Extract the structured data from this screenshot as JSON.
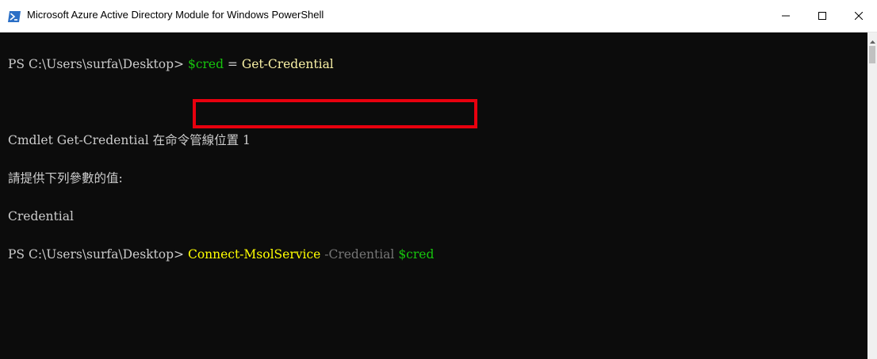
{
  "window": {
    "title": "Microsoft Azure Active Directory Module for Windows PowerShell",
    "icon": "powershell-icon",
    "controls": [
      "minimize-icon",
      "maximize-icon",
      "close-icon"
    ]
  },
  "console": {
    "line1": {
      "prompt": "PS C:\\Users\\surfa\\Desktop> ",
      "variable": "$cred",
      "operator": " = ",
      "command": "Get-Credential"
    },
    "line2": "",
    "line3": "Cmdlet Get-Credential 在命令管線位置 1",
    "line4": "請提供下列參數的值:",
    "line5": "Credential",
    "line6": {
      "prompt": "PS C:\\Users\\surfa\\Desktop> ",
      "command": "Connect-MsolService",
      "parameter": " -Credential",
      "argument": " $cred"
    }
  },
  "colors": {
    "console_bg": "#0c0c0c",
    "text": "#cccccc",
    "command": "#f9f1a5",
    "parameter": "#767676",
    "variable": "#16c60c",
    "highlight_border": "#e8000e"
  }
}
